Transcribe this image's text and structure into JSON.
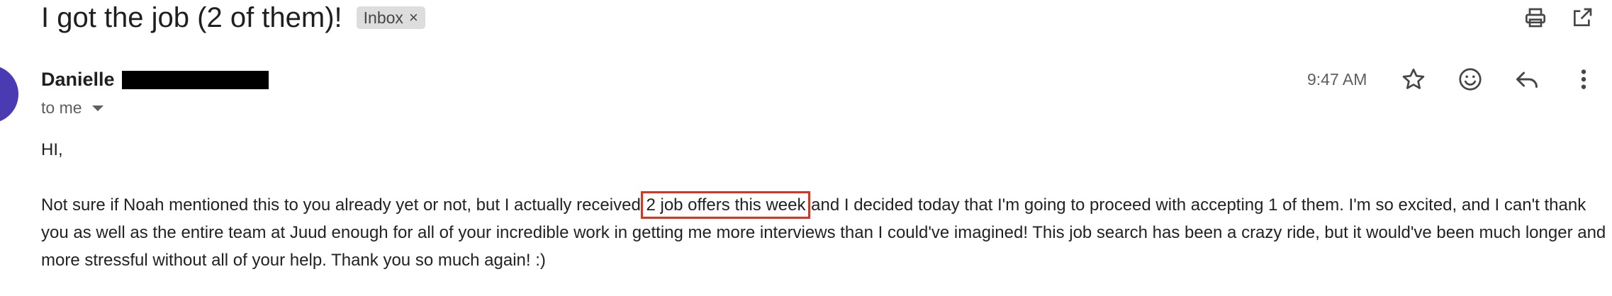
{
  "email": {
    "subject": "I got the job (2 of them)!",
    "label": "Inbox",
    "label_remove": "×",
    "sender_name": "Danielle",
    "recipient": "to me",
    "time": "9:47 AM",
    "greeting": "HI,",
    "body_before": "Not sure if Noah mentioned this to you already yet or not, but I actually received ",
    "body_highlight": "2 job offers this week",
    "body_after": " and I decided today that I'm going to proceed with accepting 1 of them. I'm so excited, and I can't thank you as well as the entire team at Juud enough for all of your incredible work in getting me more interviews than I could've imagined! This job search has been a crazy ride, but it would've been much longer and more stressful without all of your help. Thank you so much again! :)"
  },
  "icons": {
    "print": "print-icon",
    "open_new_window": "open-in-new-window-icon",
    "star": "star-icon",
    "emoji": "emoji-reaction-icon",
    "reply": "reply-icon",
    "more": "more-vertical-icon",
    "dropdown": "chevron-down-icon"
  },
  "colors": {
    "avatar": "#4b3bb3",
    "highlight_box": "#e0321c",
    "label_chip_bg": "#dddddd",
    "redaction": "#000000"
  }
}
